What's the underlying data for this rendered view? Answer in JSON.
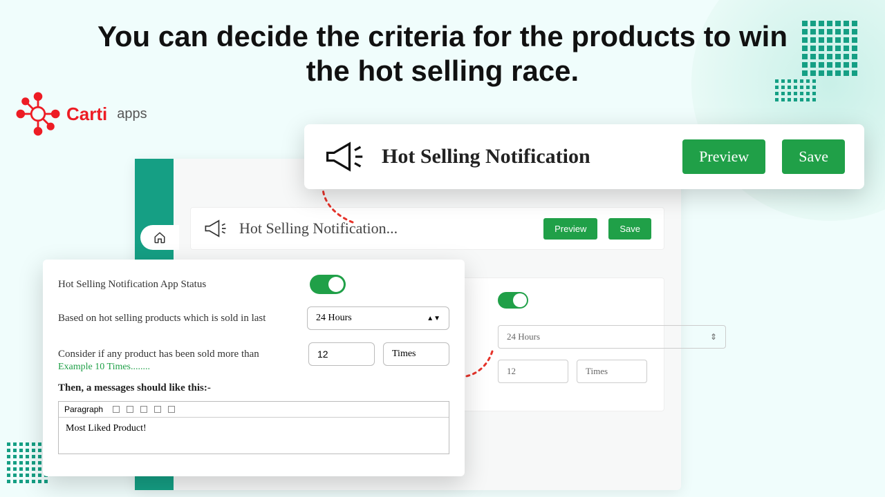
{
  "headline": "You can decide the criteria for the products to win the hot selling race.",
  "logo": {
    "brand": "Carti",
    "sub": "apps"
  },
  "front_header": {
    "title": "Hot Selling Notification",
    "preview": "Preview",
    "save": "Save"
  },
  "back_header": {
    "title": "Hot Selling Notification...",
    "preview": "Preview",
    "save": "Save"
  },
  "back_body": {
    "select_value": "24 Hours",
    "num_value": "12",
    "times_label": "Times"
  },
  "card": {
    "status_label": "Hot Selling Notification App Status",
    "based_label": "Based on hot selling products which is sold in last",
    "period_value": "24 Hours",
    "consider_label": "Consider if any product has been sold more than",
    "example": "Example 10 Times........",
    "count_value": "12",
    "times_label": "Times",
    "msg_label": "Then, a messages should like this:-",
    "format_label": "Paragraph",
    "msg_value": "Most Liked Product!"
  }
}
